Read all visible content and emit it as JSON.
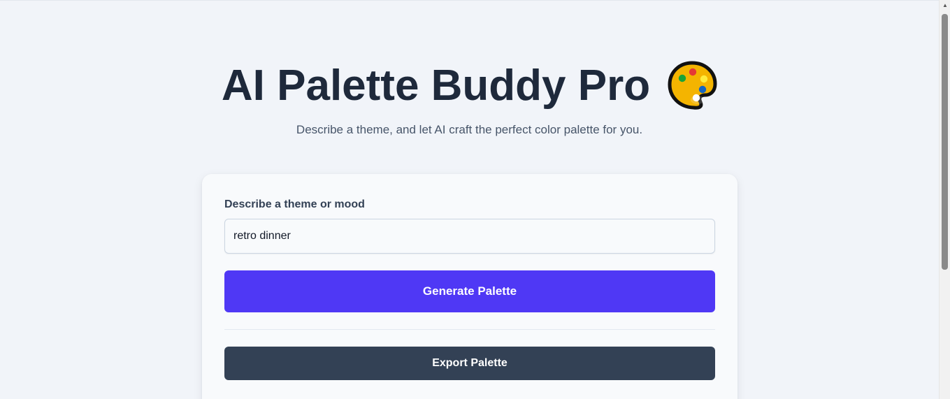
{
  "header": {
    "title": "AI Palette Buddy Pro",
    "title_icon": "artist-palette-icon",
    "subtitle": "Describe a theme, and let AI craft the perfect color palette for you."
  },
  "form": {
    "label": "Describe a theme or mood",
    "input_value": "retro dinner",
    "generate_label": "Generate Palette",
    "export_label": "Export Palette"
  },
  "colors": {
    "background": "#f1f4f9",
    "title": "#1e293b",
    "primary_button": "#4f38f5",
    "secondary_button": "#334155",
    "card": "#f8fafc"
  },
  "scrollbar": {
    "up_arrow": "▲"
  }
}
